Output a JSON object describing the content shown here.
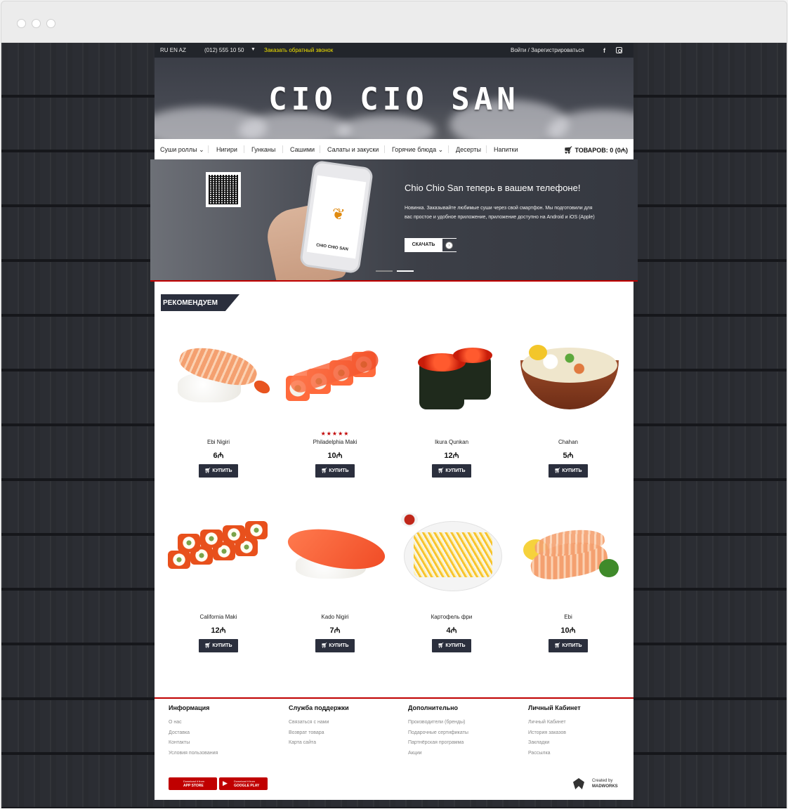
{
  "topbar": {
    "languages": "RU EN AZ",
    "phone": "(012) 555 10 50",
    "callback": "Заказать обратный звонок",
    "login": "Войти / Зарегистрироваться"
  },
  "header": {
    "logo": "CIO CIO SAN"
  },
  "nav": {
    "items": [
      "Суши роллы",
      "Нигири",
      "Гунканы",
      "Сашими",
      "Салаты и закуски",
      "Горячие блюда",
      "Десерты",
      "Напитки"
    ],
    "cart": "ТОВАРОВ: 0 (0₼)"
  },
  "banner": {
    "title": "Chio Chio San теперь в вашем телефоне!",
    "text": "Новинка. Заказывайте любимые суши через свой смартфон. Мы подготовили для вас простое и удобное приложение, приложение доступно на Android и iOS (Apple)",
    "button": "СКАЧАТЬ",
    "phone_brand": "CHIO CHIO SAN"
  },
  "recommended": {
    "label": "РЕКОМЕНДУЕМ"
  },
  "products": [
    {
      "name": "Ebi Nigiri",
      "price": "6₼",
      "stars": ""
    },
    {
      "name": "Philadelphia Maki",
      "price": "10₼",
      "stars": "★★★★★"
    },
    {
      "name": "Ikura Qunkan",
      "price": "12₼",
      "stars": ""
    },
    {
      "name": "Chahan",
      "price": "5₼",
      "stars": ""
    },
    {
      "name": "California Maki",
      "price": "12₼",
      "stars": ""
    },
    {
      "name": "Kado Nigiri",
      "price": "7₼",
      "stars": ""
    },
    {
      "name": "Картофель фри",
      "price": "4₼",
      "stars": ""
    },
    {
      "name": "Ebi",
      "price": "10₼",
      "stars": ""
    }
  ],
  "buy_label": "КУПИТЬ",
  "footer": {
    "columns": [
      {
        "title": "Информация",
        "links": [
          "О нас",
          "Доставка",
          "Контакты",
          "Условия пользования"
        ]
      },
      {
        "title": "Служба поддержки",
        "links": [
          "Связаться с нами",
          "Возврат товара",
          "Карта сайта"
        ]
      },
      {
        "title": "Дополнительно",
        "links": [
          "Производители (бренды)",
          "Подарочные сертификаты",
          "Партнёрская программа",
          "Акции"
        ]
      },
      {
        "title": "Личный Кабинет",
        "links": [
          "Личный Кабинет",
          "История заказов",
          "Закладки",
          "Рассылка"
        ]
      }
    ],
    "app_store": {
      "small": "Download it from",
      "big": "APP STORE"
    },
    "google_play": {
      "small": "Download it from",
      "big": "GOOGLE PLAY"
    },
    "created_by": "Created by",
    "madworks": "MADWORKS"
  },
  "colors": {
    "accent": "#c00000",
    "dark": "#2b2f3d",
    "callback": "#f0e000"
  }
}
